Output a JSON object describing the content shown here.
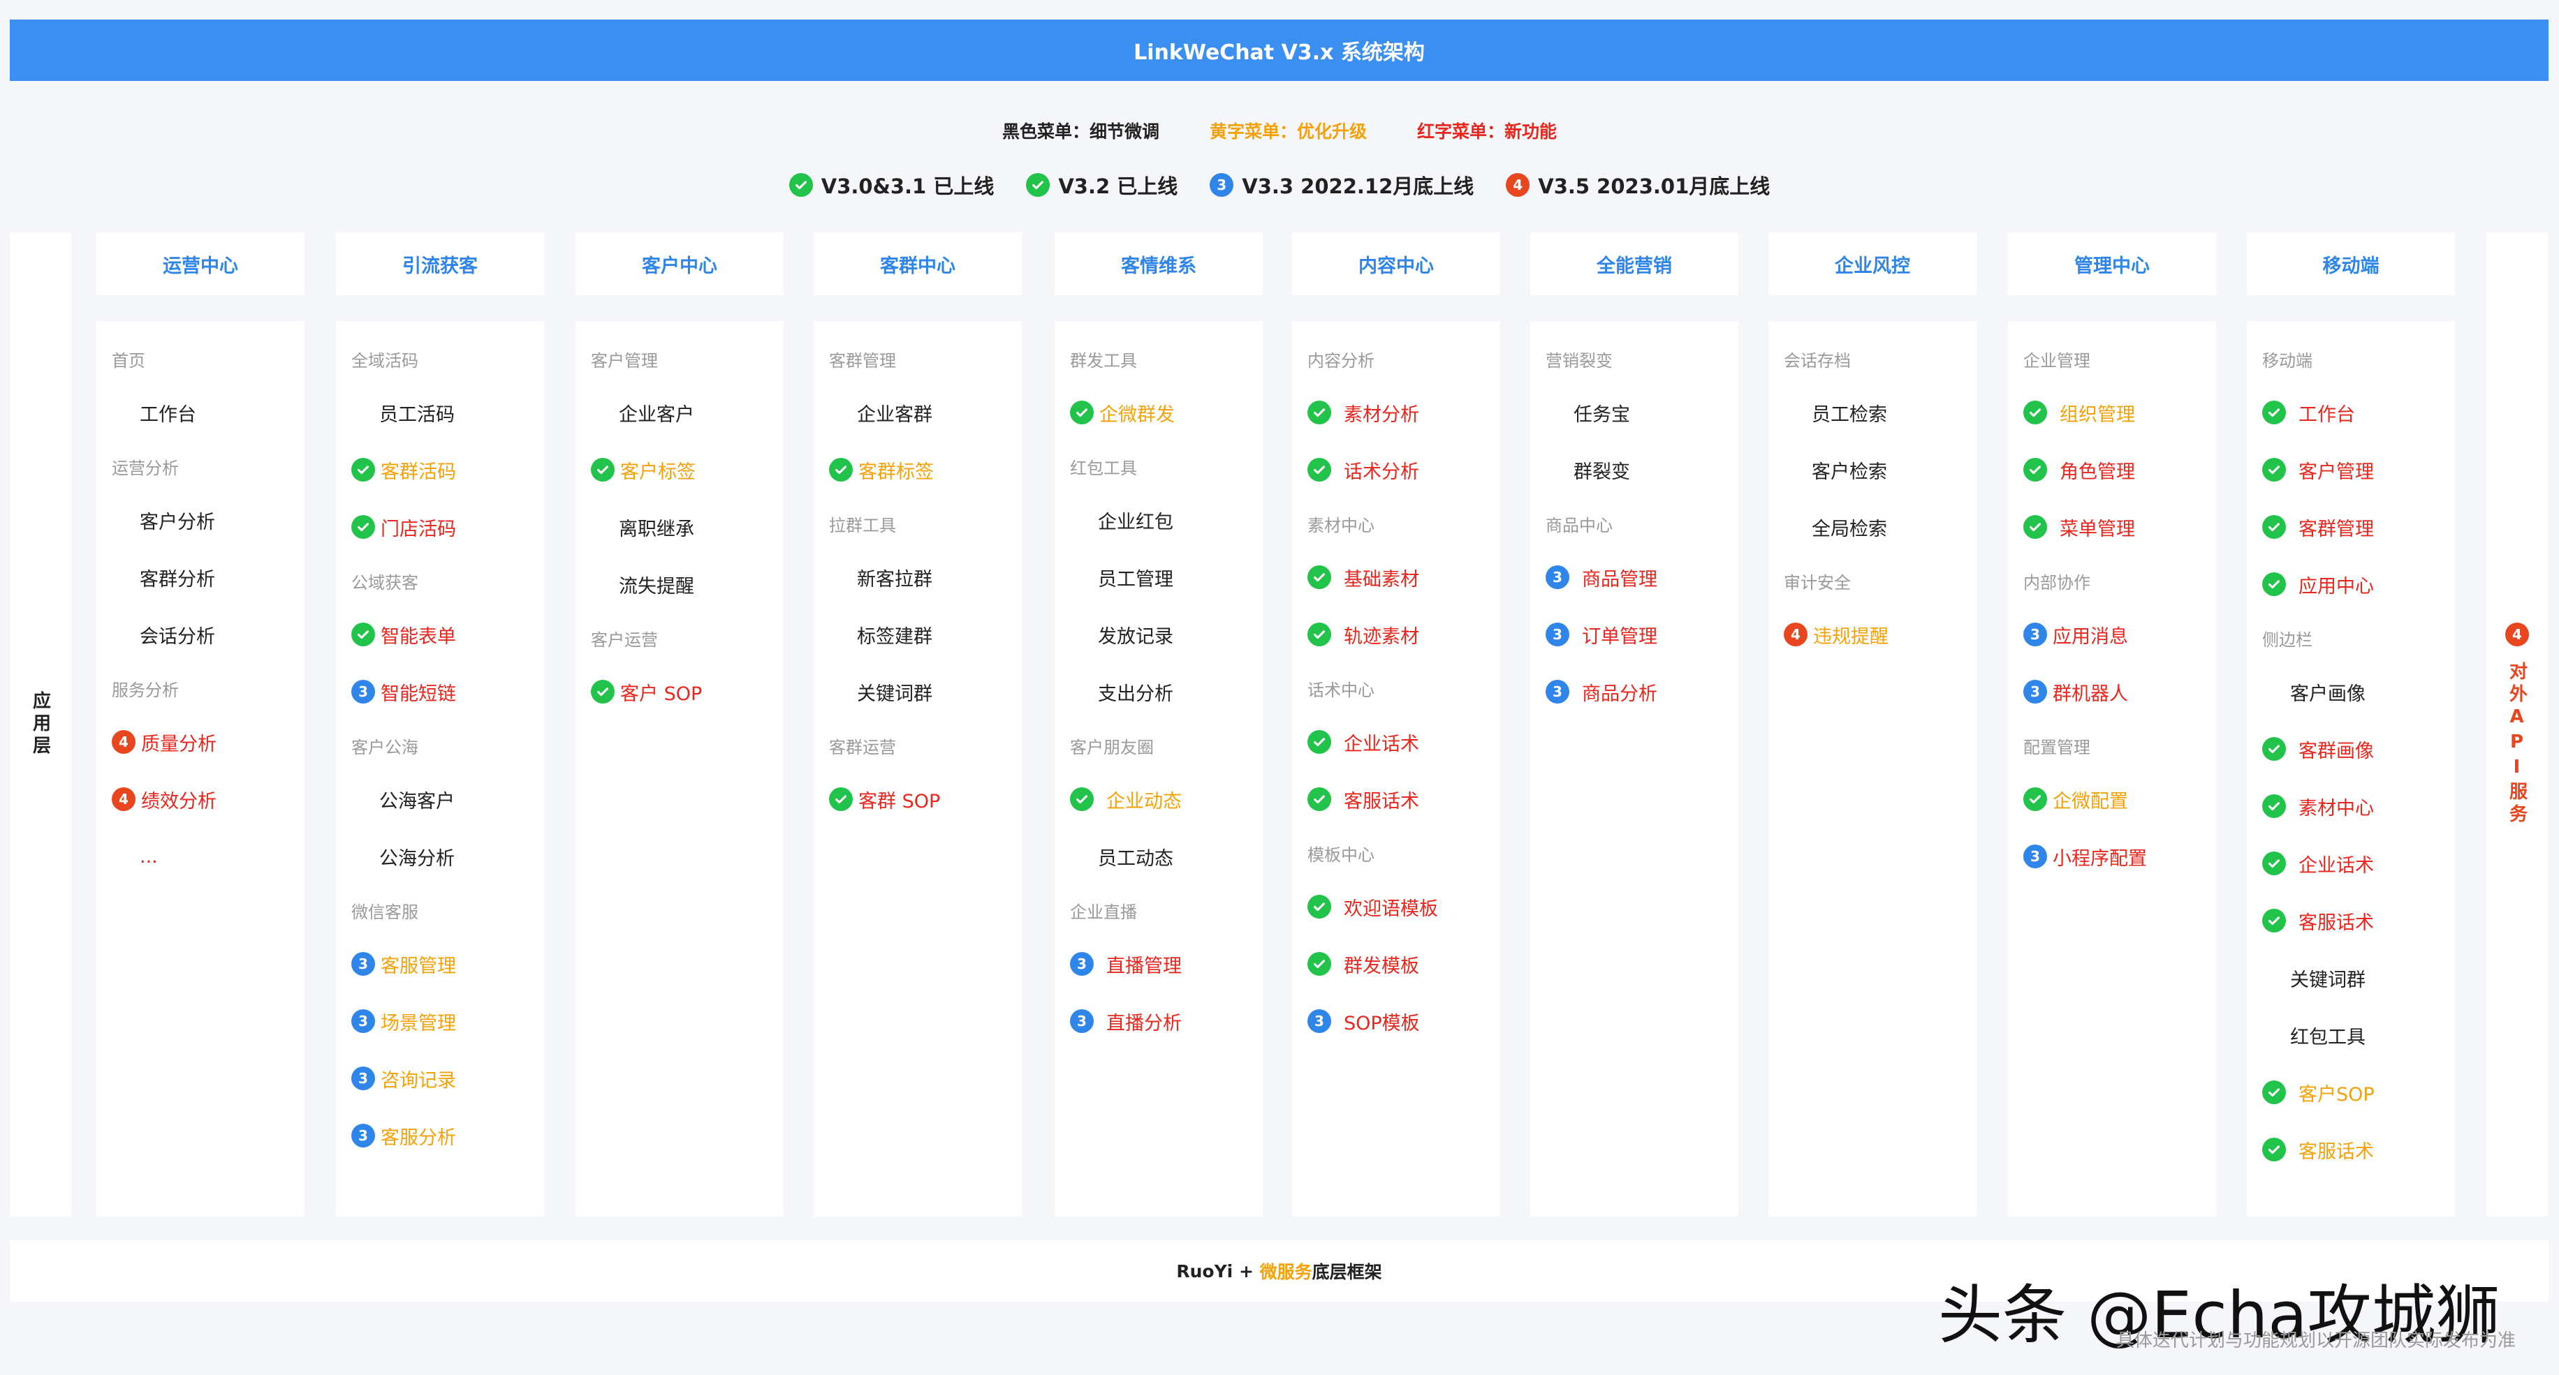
{
  "header": {
    "title": "LinkWeChat V3.x 系统架构"
  },
  "legend": [
    {
      "text": "黑色菜单：细节微调",
      "color": "#222222"
    },
    {
      "text": "黄字菜单：优化升级",
      "color": "#f5a20a"
    },
    {
      "text": "红字菜单：新功能",
      "color": "#e8271e"
    }
  ],
  "status": [
    {
      "badge": "check",
      "text": "V3.0&3.1 已上线"
    },
    {
      "badge": "check",
      "text": "V3.2 已上线"
    },
    {
      "badge": "3",
      "text": "V3.3 2022.12月底上线"
    },
    {
      "badge": "4",
      "text": "V3.5 2023.01月底上线"
    }
  ],
  "side_left": {
    "label": "应用层"
  },
  "side_right": {
    "badge": "4",
    "label": "对外API服务"
  },
  "columns": [
    {
      "title": "运营中心",
      "rows": [
        {
          "kind": "section",
          "text": "首页"
        },
        {
          "kind": "item",
          "text": "工作台",
          "color": "k"
        },
        {
          "kind": "section",
          "text": "运营分析"
        },
        {
          "kind": "item",
          "text": "客户分析",
          "color": "k"
        },
        {
          "kind": "item",
          "text": "客群分析",
          "color": "k"
        },
        {
          "kind": "item",
          "text": "会话分析",
          "color": "k"
        },
        {
          "kind": "section",
          "text": "服务分析"
        },
        {
          "kind": "item",
          "text": "质量分析",
          "color": "r",
          "badge": "4"
        },
        {
          "kind": "item",
          "text": "绩效分析",
          "color": "r",
          "badge": "4"
        },
        {
          "kind": "item",
          "text": "...",
          "color": "r"
        }
      ]
    },
    {
      "title": "引流获客",
      "rows": [
        {
          "kind": "section",
          "text": "全域活码"
        },
        {
          "kind": "item",
          "text": "员工活码",
          "color": "k"
        },
        {
          "kind": "item",
          "text": "客群活码",
          "color": "y",
          "badge": "check"
        },
        {
          "kind": "item",
          "text": "门店活码",
          "color": "r",
          "badge": "check"
        },
        {
          "kind": "section",
          "text": "公域获客"
        },
        {
          "kind": "item",
          "text": "智能表单",
          "color": "r",
          "badge": "check"
        },
        {
          "kind": "item",
          "text": "智能短链",
          "color": "r",
          "badge": "3"
        },
        {
          "kind": "section",
          "text": "客户公海"
        },
        {
          "kind": "item",
          "text": "公海客户",
          "color": "k"
        },
        {
          "kind": "item",
          "text": "公海分析",
          "color": "k"
        },
        {
          "kind": "section",
          "text": "微信客服"
        },
        {
          "kind": "item",
          "text": "客服管理",
          "color": "y",
          "badge": "3"
        },
        {
          "kind": "item",
          "text": "场景管理",
          "color": "y",
          "badge": "3"
        },
        {
          "kind": "item",
          "text": "咨询记录",
          "color": "y",
          "badge": "3"
        },
        {
          "kind": "item",
          "text": "客服分析",
          "color": "y",
          "badge": "3"
        }
      ]
    },
    {
      "title": "客户中心",
      "rows": [
        {
          "kind": "section",
          "text": "客户管理"
        },
        {
          "kind": "item",
          "text": "企业客户",
          "color": "k"
        },
        {
          "kind": "item",
          "text": "客户标签",
          "color": "y",
          "badge": "check"
        },
        {
          "kind": "item",
          "text": "离职继承",
          "color": "k"
        },
        {
          "kind": "item",
          "text": "流失提醒",
          "color": "k"
        },
        {
          "kind": "section",
          "text": "客户运营"
        },
        {
          "kind": "item",
          "text": "客户 SOP",
          "color": "r",
          "badge": "check"
        }
      ]
    },
    {
      "title": "客群中心",
      "rows": [
        {
          "kind": "section",
          "text": "客群管理"
        },
        {
          "kind": "item",
          "text": "企业客群",
          "color": "k"
        },
        {
          "kind": "item",
          "text": "客群标签",
          "color": "y",
          "badge": "check"
        },
        {
          "kind": "section",
          "text": "拉群工具"
        },
        {
          "kind": "item",
          "text": "新客拉群",
          "color": "k"
        },
        {
          "kind": "item",
          "text": "标签建群",
          "color": "k"
        },
        {
          "kind": "item",
          "text": "关键词群",
          "color": "k"
        },
        {
          "kind": "section",
          "text": "客群运营"
        },
        {
          "kind": "item",
          "text": "客群 SOP",
          "color": "r",
          "badge": "check"
        }
      ]
    },
    {
      "title": "客情维系",
      "rows": [
        {
          "kind": "section",
          "text": "群发工具"
        },
        {
          "kind": "item",
          "text": "企微群发",
          "color": "y",
          "badge": "check"
        },
        {
          "kind": "section",
          "text": "红包工具"
        },
        {
          "kind": "item",
          "text": "企业红包",
          "color": "k"
        },
        {
          "kind": "item",
          "text": "员工管理",
          "color": "k"
        },
        {
          "kind": "item",
          "text": "发放记录",
          "color": "k"
        },
        {
          "kind": "item",
          "text": "支出分析",
          "color": "k"
        },
        {
          "kind": "section",
          "text": "客户朋友圈"
        },
        {
          "kind": "item",
          "text": "企业动态",
          "color": "y",
          "badge": "check",
          "spaced": true
        },
        {
          "kind": "item",
          "text": "员工动态",
          "color": "k"
        },
        {
          "kind": "section",
          "text": "企业直播"
        },
        {
          "kind": "item",
          "text": "直播管理",
          "color": "r",
          "badge": "3",
          "spaced": true
        },
        {
          "kind": "item",
          "text": "直播分析",
          "color": "r",
          "badge": "3",
          "spaced": true
        }
      ]
    },
    {
      "title": "内容中心",
      "rows": [
        {
          "kind": "section",
          "text": "内容分析"
        },
        {
          "kind": "item",
          "text": "素材分析",
          "color": "r",
          "badge": "check",
          "spaced": true
        },
        {
          "kind": "item",
          "text": "话术分析",
          "color": "r",
          "badge": "check",
          "spaced": true
        },
        {
          "kind": "section",
          "text": "素材中心"
        },
        {
          "kind": "item",
          "text": "基础素材",
          "color": "r",
          "badge": "check",
          "spaced": true
        },
        {
          "kind": "item",
          "text": "轨迹素材",
          "color": "r",
          "badge": "check",
          "spaced": true
        },
        {
          "kind": "section",
          "text": "话术中心"
        },
        {
          "kind": "item",
          "text": "企业话术",
          "color": "r",
          "badge": "check",
          "spaced": true
        },
        {
          "kind": "item",
          "text": "客服话术",
          "color": "r",
          "badge": "check",
          "spaced": true
        },
        {
          "kind": "section",
          "text": "模板中心"
        },
        {
          "kind": "item",
          "text": "欢迎语模板",
          "color": "r",
          "badge": "check",
          "spaced": true
        },
        {
          "kind": "item",
          "text": "群发模板",
          "color": "r",
          "badge": "check",
          "spaced": true
        },
        {
          "kind": "item",
          "text": "SOP模板",
          "color": "r",
          "badge": "3",
          "spaced": true
        }
      ]
    },
    {
      "title": "全能营销",
      "rows": [
        {
          "kind": "section",
          "text": "营销裂变"
        },
        {
          "kind": "item",
          "text": "任务宝",
          "color": "k"
        },
        {
          "kind": "item",
          "text": "群裂变",
          "color": "k"
        },
        {
          "kind": "section",
          "text": "商品中心"
        },
        {
          "kind": "item",
          "text": "商品管理",
          "color": "r",
          "badge": "3",
          "spaced": true
        },
        {
          "kind": "item",
          "text": "订单管理",
          "color": "r",
          "badge": "3",
          "spaced": true
        },
        {
          "kind": "item",
          "text": "商品分析",
          "color": "r",
          "badge": "3",
          "spaced": true
        }
      ]
    },
    {
      "title": "企业风控",
      "rows": [
        {
          "kind": "section",
          "text": "会话存档"
        },
        {
          "kind": "item",
          "text": "员工检索",
          "color": "k"
        },
        {
          "kind": "item",
          "text": "客户检索",
          "color": "k"
        },
        {
          "kind": "item",
          "text": "全局检索",
          "color": "k"
        },
        {
          "kind": "section",
          "text": "审计安全"
        },
        {
          "kind": "item",
          "text": "违规提醒",
          "color": "y",
          "badge": "4"
        }
      ]
    },
    {
      "title": "管理中心",
      "rows": [
        {
          "kind": "section",
          "text": "企业管理"
        },
        {
          "kind": "item",
          "text": "组织管理",
          "color": "y",
          "badge": "check",
          "spaced": true
        },
        {
          "kind": "item",
          "text": "角色管理",
          "color": "r",
          "badge": "check",
          "spaced": true
        },
        {
          "kind": "item",
          "text": "菜单管理",
          "color": "r",
          "badge": "check",
          "spaced": true
        },
        {
          "kind": "section",
          "text": "内部协作"
        },
        {
          "kind": "item",
          "text": "应用消息",
          "color": "r",
          "badge": "3"
        },
        {
          "kind": "item",
          "text": "群机器人",
          "color": "r",
          "badge": "3"
        },
        {
          "kind": "section",
          "text": "配置管理"
        },
        {
          "kind": "item",
          "text": "企微配置",
          "color": "y",
          "badge": "check"
        },
        {
          "kind": "item",
          "text": "小程序配置",
          "color": "r",
          "badge": "3"
        }
      ]
    },
    {
      "title": "移动端",
      "rows": [
        {
          "kind": "section",
          "text": "移动端"
        },
        {
          "kind": "item",
          "text": "工作台",
          "color": "r",
          "badge": "check",
          "spaced": true
        },
        {
          "kind": "item",
          "text": "客户管理",
          "color": "r",
          "badge": "check",
          "spaced": true
        },
        {
          "kind": "item",
          "text": "客群管理",
          "color": "r",
          "badge": "check",
          "spaced": true
        },
        {
          "kind": "item",
          "text": "应用中心",
          "color": "r",
          "badge": "check",
          "spaced": true
        },
        {
          "kind": "section",
          "text": "侧边栏"
        },
        {
          "kind": "item",
          "text": "客户画像",
          "color": "k"
        },
        {
          "kind": "item",
          "text": "客群画像",
          "color": "r",
          "badge": "check",
          "spaced": true
        },
        {
          "kind": "item",
          "text": "素材中心",
          "color": "r",
          "badge": "check",
          "spaced": true
        },
        {
          "kind": "item",
          "text": "企业话术",
          "color": "r",
          "badge": "check",
          "spaced": true
        },
        {
          "kind": "item",
          "text": "客服话术",
          "color": "r",
          "badge": "check",
          "spaced": true
        },
        {
          "kind": "item",
          "text": "关键词群",
          "color": "k"
        },
        {
          "kind": "item",
          "text": "红包工具",
          "color": "k"
        },
        {
          "kind": "item",
          "text": "客户SOP",
          "color": "y",
          "badge": "check",
          "spaced": true
        },
        {
          "kind": "item",
          "text": "客服话术",
          "color": "y",
          "badge": "check",
          "spaced": true
        }
      ]
    }
  ],
  "footer": {
    "prefix": "RuoYi + ",
    "highlight": "微服务",
    "suffix": "底层框架"
  },
  "watermark": {
    "text": "头条 @Echa攻城狮"
  },
  "footnote": {
    "text": "具体迭代计划与功能规划以开源团队实际发布为准"
  }
}
